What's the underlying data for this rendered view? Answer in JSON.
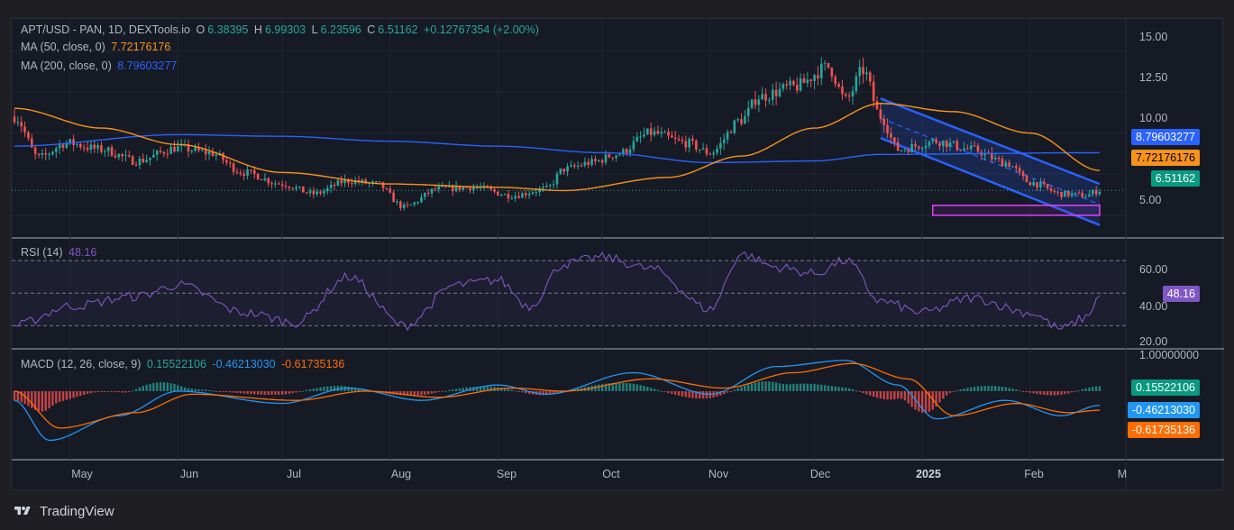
{
  "header": {
    "symbol": "APT/USD - PAN, 1D, DEXTools.io",
    "open_label": "O",
    "open": "6.38395",
    "high_label": "H",
    "high": "6.99303",
    "low_label": "L",
    "low": "6.23596",
    "close_label": "C",
    "close": "6.51162",
    "change": "+0.12767354 (+2.00%)"
  },
  "ma50": {
    "label": "MA (50, close, 0)",
    "value": "7.72176176",
    "color": "#f7931a"
  },
  "ma200": {
    "label": "MA (200, close, 0)",
    "value": "8.79603277",
    "color": "#2962ff"
  },
  "rsi": {
    "label": "RSI (14)",
    "value": "48.16",
    "color": "#7e57c2"
  },
  "macd": {
    "label": "MACD (12, 26, close, 9)",
    "hist": "0.15522106",
    "macd_line": "-0.46213030",
    "signal": "-0.61735136",
    "colors": {
      "hist_up": "#26a69a",
      "hist_down": "#ff5252",
      "macd": "#2196f3",
      "signal": "#ff6d00"
    }
  },
  "price_axis": [
    "15.00",
    "12.50",
    "10.00",
    "5.00"
  ],
  "rsi_axis": [
    "60.00",
    "40.00",
    "20.00"
  ],
  "macd_axis": [
    "1.00000000"
  ],
  "badges": {
    "ma200": "8.79603277",
    "ma50": "7.72176176",
    "price": "6.51162",
    "rsi": "48.16",
    "hist": "0.15522106",
    "macd": "-0.46213030",
    "signal": "-0.61735136"
  },
  "x_axis": [
    "May",
    "Jun",
    "Jul",
    "Aug",
    "Sep",
    "Oct",
    "Nov",
    "Dec",
    "2025",
    "Feb",
    "M"
  ],
  "footer": {
    "brand": "TradingView"
  },
  "chart_data": {
    "type": "candlestick",
    "title": "APT/USD - PAN, 1D, DEXTools.io",
    "price_anchors": [
      [
        "Apr 15",
        11.0
      ],
      [
        "Apr 22",
        8.5
      ],
      [
        "Apr 30",
        9.4
      ],
      [
        "May 10",
        9.0
      ],
      [
        "May 20",
        8.3
      ],
      [
        "Jun 1",
        9.1
      ],
      [
        "Jun 10",
        8.8
      ],
      [
        "Jun 20",
        7.6
      ],
      [
        "Jul 1",
        6.9
      ],
      [
        "Jul 10",
        6.3
      ],
      [
        "Jul 20",
        7.1
      ],
      [
        "Jul 28",
        6.9
      ],
      [
        "Aug 5",
        5.5
      ],
      [
        "Aug 15",
        6.6
      ],
      [
        "Aug 25",
        6.7
      ],
      [
        "Sep 5",
        6.2
      ],
      [
        "Sep 15",
        6.6
      ],
      [
        "Sep 20",
        7.8
      ],
      [
        "Sep 28",
        8.2
      ],
      [
        "Oct 5",
        8.7
      ],
      [
        "Oct 15",
        10.0
      ],
      [
        "Oct 25",
        9.4
      ],
      [
        "Nov 1",
        8.8
      ],
      [
        "Nov 10",
        10.8
      ],
      [
        "Nov 15",
        12.2
      ],
      [
        "Nov 25",
        12.8
      ],
      [
        "Dec 5",
        14.0
      ],
      [
        "Dec 10",
        12.0
      ],
      [
        "Dec 15",
        13.8
      ],
      [
        "Dec 20",
        11.0
      ],
      [
        "Dec 25",
        9.0
      ],
      [
        "Jan 5",
        9.5
      ],
      [
        "Jan 15",
        9.0
      ],
      [
        "Jan 25",
        8.2
      ],
      [
        "Feb 1",
        7.0
      ],
      [
        "Feb 10",
        6.3
      ],
      [
        "Feb 17",
        6.2
      ],
      [
        "Feb 21",
        6.51
      ]
    ],
    "ma50_anchors": [
      [
        "Apr 15",
        11.5
      ],
      [
        "May 10",
        10.3
      ],
      [
        "Jun 1",
        9.3
      ],
      [
        "Jul 1",
        7.6
      ],
      [
        "Aug 1",
        6.9
      ],
      [
        "Sep 1",
        6.7
      ],
      [
        "Sep 20",
        6.5
      ],
      [
        "Oct 20",
        7.3
      ],
      [
        "Nov 10",
        8.6
      ],
      [
        "Dec 1",
        10.3
      ],
      [
        "Dec 20",
        11.8
      ],
      [
        "Jan 10",
        11.3
      ],
      [
        "Feb 1",
        10.0
      ],
      [
        "Feb 21",
        7.72
      ]
    ],
    "ma200_anchors": [
      [
        "Apr 15",
        9.2
      ],
      [
        "Jun 1",
        9.9
      ],
      [
        "Jul 1",
        9.8
      ],
      [
        "Aug 1",
        9.5
      ],
      [
        "Sep 1",
        9.2
      ],
      [
        "Oct 1",
        8.8
      ],
      [
        "Nov 1",
        8.2
      ],
      [
        "Dec 1",
        8.3
      ],
      [
        "Dec 20",
        8.7
      ],
      [
        "Feb 21",
        8.8
      ]
    ],
    "channel": {
      "upper": [
        [
          "Dec 20",
          12.1
        ],
        [
          "Feb 21",
          6.9
        ]
      ],
      "lower": [
        [
          "Dec 20",
          9.7
        ],
        [
          "Feb 21",
          4.4
        ]
      ]
    },
    "support_zone": {
      "from": "Jan 4",
      "to": "Feb 21",
      "low": 5.0,
      "high": 5.6
    },
    "rsi_anchors": [
      [
        "Apr 15",
        30
      ],
      [
        "May 1",
        42
      ],
      [
        "May 20",
        48
      ],
      [
        "Jun 1",
        55
      ],
      [
        "Jun 20",
        38
      ],
      [
        "Jul 5",
        32
      ],
      [
        "Jul 20",
        60
      ],
      [
        "Aug 5",
        30
      ],
      [
        "Aug 20",
        55
      ],
      [
        "Sep 1",
        58
      ],
      [
        "Sep 10",
        42
      ],
      [
        "Sep 20",
        68
      ],
      [
        "Oct 1",
        72
      ],
      [
        "Oct 15",
        65
      ],
      [
        "Nov 1",
        40
      ],
      [
        "Nov 10",
        74
      ],
      [
        "Nov 20",
        66
      ],
      [
        "Dec 1",
        62
      ],
      [
        "Dec 10",
        70
      ],
      [
        "Dec 20",
        45
      ],
      [
        "Jan 1",
        38
      ],
      [
        "Jan 15",
        47
      ],
      [
        "Feb 1",
        38
      ],
      [
        "Feb 10",
        28
      ],
      [
        "Feb 17",
        35
      ],
      [
        "Feb 21",
        48.16
      ]
    ],
    "macd_anchors": [
      [
        "Apr 15",
        -0.3
      ],
      [
        "Apr 25",
        -1.6
      ],
      [
        "May 15",
        -0.8
      ],
      [
        "Jun 1",
        0.0
      ],
      [
        "Jul 1",
        -0.4
      ],
      [
        "Jul 20",
        0.1
      ],
      [
        "Aug 10",
        -0.3
      ],
      [
        "Sep 1",
        0.2
      ],
      [
        "Sep 15",
        -0.1
      ],
      [
        "Oct 10",
        0.6
      ],
      [
        "Nov 1",
        -0.1
      ],
      [
        "Nov 20",
        0.8
      ],
      [
        "Dec 10",
        1.0
      ],
      [
        "Dec 25",
        0.2
      ],
      [
        "Jan 5",
        -0.9
      ],
      [
        "Jan 25",
        -0.3
      ],
      [
        "Feb 10",
        -0.8
      ],
      [
        "Feb 21",
        -0.46
      ]
    ],
    "signal_anchors": [
      [
        "Apr 15",
        0.0
      ],
      [
        "Apr 28",
        -1.2
      ],
      [
        "May 20",
        -0.7
      ],
      [
        "Jun 5",
        -0.1
      ],
      [
        "Jul 5",
        -0.3
      ],
      [
        "Jul 25",
        0.0
      ],
      [
        "Aug 15",
        -0.2
      ],
      [
        "Sep 5",
        0.1
      ],
      [
        "Sep 20",
        0.0
      ],
      [
        "Oct 15",
        0.4
      ],
      [
        "Nov 5",
        0.1
      ],
      [
        "Nov 25",
        0.6
      ],
      [
        "Dec 12",
        0.9
      ],
      [
        "Dec 28",
        0.4
      ],
      [
        "Jan 10",
        -0.8
      ],
      [
        "Jan 28",
        -0.4
      ],
      [
        "Feb 12",
        -0.7
      ],
      [
        "Feb 21",
        -0.62
      ]
    ],
    "price_ylim": [
      4.0,
      16.5
    ],
    "rsi_ylim": [
      18,
      80
    ],
    "macd_ylim": [
      -2.2,
      1.2
    ],
    "rsi_levels": [
      70,
      50,
      30
    ],
    "grid": true
  }
}
